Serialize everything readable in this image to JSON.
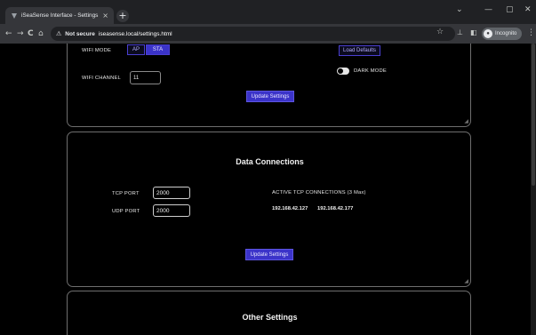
{
  "browser": {
    "tab_title": "iSeaSense Interface - Settings",
    "tab_close": "×",
    "new_tab": "+",
    "back": "←",
    "forward": "→",
    "reload": "C",
    "home": "⌂",
    "security_icon": "⚠",
    "not_secure": "Not secure",
    "url": "iseasense.local/settings.html",
    "incognito_label": "Incognito",
    "window_minimize": "—",
    "window_maximize": "▢",
    "window_close": "✕",
    "tab_list": "⌄"
  },
  "wifi": {
    "mode_label": "WIFI MODE",
    "mode_options": [
      "AP",
      "STA"
    ],
    "mode_selected": "STA",
    "channel_label": "WIFI CHANNEL",
    "channel_value": "11",
    "load_defaults": "Load Defaults",
    "dark_mode_label": "DARK MODE",
    "dark_mode_on": true,
    "update_button": "Update Settings"
  },
  "data_connections": {
    "title": "Data Connections",
    "tcp_port_label": "TCP PORT",
    "tcp_port_value": "2000",
    "udp_port_label": "UDP PORT",
    "udp_port_value": "2000",
    "active_label": "ACTIVE TCP CONNECTIONS (3 Max)",
    "active_ips": [
      "192.168.42.127",
      "192.168.42.177"
    ],
    "update_button": "Update Settings"
  },
  "other_settings": {
    "title": "Other Settings"
  },
  "colors": {
    "accent": "#3b33c9",
    "card_border": "#6e6e6e",
    "background": "#000000"
  }
}
